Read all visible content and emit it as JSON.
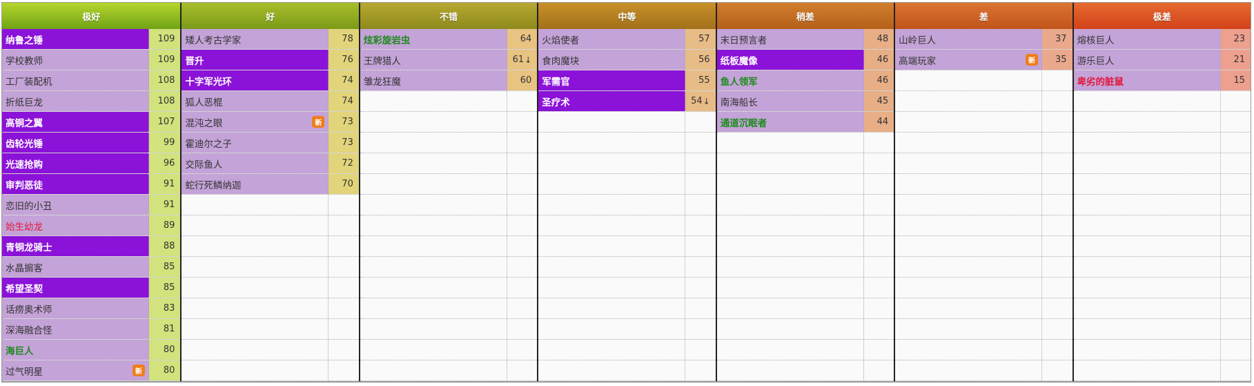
{
  "badge_new_label": "新",
  "tiers": [
    {
      "label": "极好",
      "header_gradient": [
        "#b6d62c",
        "#6fa316"
      ],
      "score_bg": "#d2e27c",
      "cards": [
        {
          "name": "纳鲁之锤",
          "score": "109",
          "style": "bold"
        },
        {
          "name": "学校教师",
          "score": "109",
          "style": "normal"
        },
        {
          "name": "工厂装配机",
          "score": "108",
          "style": "normal"
        },
        {
          "name": "折纸巨龙",
          "score": "108",
          "style": "normal"
        },
        {
          "name": "高铜之翼",
          "score": "107",
          "style": "bold"
        },
        {
          "name": "齿轮光锤",
          "score": "99",
          "style": "bold"
        },
        {
          "name": "光速抢购",
          "score": "96",
          "style": "bold"
        },
        {
          "name": "审判恶徒",
          "score": "91",
          "style": "bold"
        },
        {
          "name": "恋旧的小丑",
          "score": "91",
          "style": "normal"
        },
        {
          "name": "始生幼龙",
          "score": "89",
          "style": "red"
        },
        {
          "name": "青铜龙骑士",
          "score": "88",
          "style": "bold"
        },
        {
          "name": "水晶掮客",
          "score": "85",
          "style": "normal"
        },
        {
          "name": "希望圣契",
          "score": "85",
          "style": "bold"
        },
        {
          "name": "话痨奥术师",
          "score": "83",
          "style": "normal"
        },
        {
          "name": "深海融合怪",
          "score": "81",
          "style": "normal"
        },
        {
          "name": "海巨人",
          "score": "80",
          "style": "green"
        },
        {
          "name": "过气明星",
          "score": "80",
          "style": "normal",
          "new": true
        }
      ]
    },
    {
      "label": "好",
      "header_gradient": [
        "#a8bd2a",
        "#7c9a1a"
      ],
      "score_bg": "#e2d47a",
      "cards": [
        {
          "name": "矮人考古学家",
          "score": "78",
          "style": "normal"
        },
        {
          "name": "晋升",
          "score": "76",
          "style": "bold"
        },
        {
          "name": "十字军光环",
          "score": "74",
          "style": "bold"
        },
        {
          "name": "狐人恶棍",
          "score": "74",
          "style": "normal"
        },
        {
          "name": "混沌之眼",
          "score": "73",
          "style": "normal",
          "new": true
        },
        {
          "name": "霍迪尔之子",
          "score": "73",
          "style": "normal"
        },
        {
          "name": "交际鱼人",
          "score": "72",
          "style": "normal"
        },
        {
          "name": "蛇行死鳞纳迦",
          "score": "70",
          "style": "normal"
        }
      ]
    },
    {
      "label": "不错",
      "header_gradient": [
        "#b8a832",
        "#8d8a1c"
      ],
      "score_bg": "#e8c382",
      "cards": [
        {
          "name": "炫彩旋岩虫",
          "score": "64",
          "style": "green"
        },
        {
          "name": "王牌猎人",
          "score": "61",
          "style": "normal",
          "down": true
        },
        {
          "name": "雏龙狂魔",
          "score": "60",
          "style": "normal"
        }
      ]
    },
    {
      "label": "中等",
      "header_gradient": [
        "#c9902a",
        "#a2711a"
      ],
      "score_bg": "#e8bc86",
      "cards": [
        {
          "name": "火焰使者",
          "score": "57",
          "style": "normal"
        },
        {
          "name": "食肉魔块",
          "score": "56",
          "style": "normal"
        },
        {
          "name": "军需官",
          "score": "55",
          "style": "bold"
        },
        {
          "name": "圣疗术",
          "score": "54",
          "style": "bold",
          "down": true
        }
      ]
    },
    {
      "label": "稍差",
      "header_gradient": [
        "#d27e2e",
        "#b5601a"
      ],
      "score_bg": "#e8ae86",
      "cards": [
        {
          "name": "末日预言者",
          "score": "48",
          "style": "normal"
        },
        {
          "name": "纸板魔像",
          "score": "46",
          "style": "bold"
        },
        {
          "name": "鱼人领军",
          "score": "46",
          "style": "green"
        },
        {
          "name": "南海船长",
          "score": "45",
          "style": "normal"
        },
        {
          "name": "通道沉眠者",
          "score": "44",
          "style": "green"
        }
      ]
    },
    {
      "label": "差",
      "header_gradient": [
        "#dc7432",
        "#c1541c"
      ],
      "score_bg": "#eaa88c",
      "cards": [
        {
          "name": "山岭巨人",
          "score": "37",
          "style": "normal"
        },
        {
          "name": "高端玩家",
          "score": "35",
          "style": "normal",
          "new": true
        }
      ]
    },
    {
      "label": "极差",
      "header_gradient": [
        "#e66a30",
        "#d2421a"
      ],
      "score_bg": "#eea08e",
      "cards": [
        {
          "name": "熔核巨人",
          "score": "23",
          "style": "normal"
        },
        {
          "name": "游乐巨人",
          "score": "21",
          "style": "normal"
        },
        {
          "name": "卑劣的脏鼠",
          "score": "15",
          "style": "redbold"
        }
      ]
    }
  ]
}
